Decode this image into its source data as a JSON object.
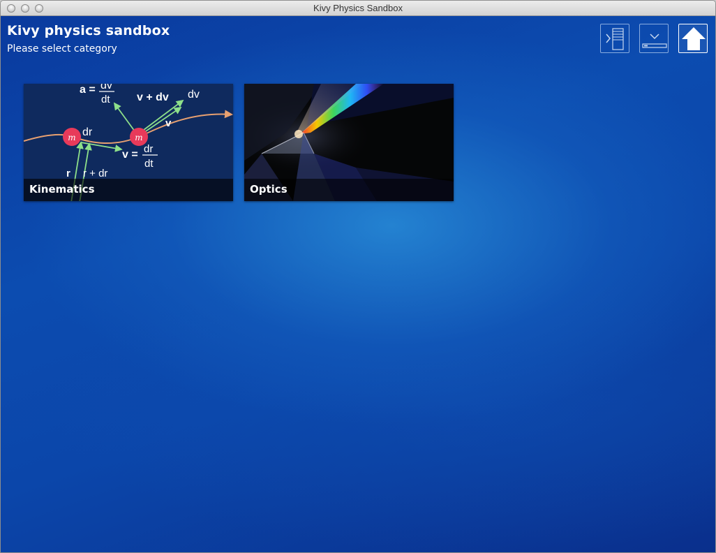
{
  "window": {
    "title": "Kivy Physics Sandbox"
  },
  "header": {
    "title": "Kivy physics sandbox",
    "subtitle": "Please select category"
  },
  "toolbar": {
    "buttons": [
      {
        "icon": "sidebar-toggle-icon"
      },
      {
        "icon": "download-icon"
      },
      {
        "icon": "home-icon"
      }
    ]
  },
  "categories": [
    {
      "label": "Kinematics",
      "image": {
        "formula_a": "a =",
        "dv_top": "dv",
        "dt_top": "dt",
        "v_plus_dv": "v + dv",
        "dv_right": "dv",
        "v": "v",
        "v_eq": "v =",
        "dr_frac": "dr",
        "dt_frac": "dt",
        "m1": "m",
        "m2": "m",
        "dr": "dr",
        "r": "r",
        "r_plus_dr": "r + dr"
      }
    },
    {
      "label": "Optics"
    }
  ],
  "colors": {
    "background_top": "#0a3a9e",
    "background_center": "#288cd7",
    "mass_dot": "#e83a5a",
    "vector_green": "#8ee08a",
    "curve_orange": "#e8a070"
  }
}
